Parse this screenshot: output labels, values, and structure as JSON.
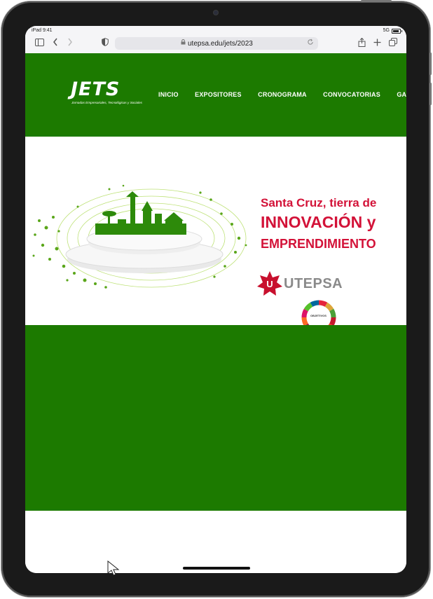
{
  "status_bar": {
    "device_time": "iPad 9:41",
    "network": "5G"
  },
  "browser": {
    "url": "utepsa.edu/jets/2023"
  },
  "site": {
    "logo_text": "JETS",
    "logo_tagline": "Jornadas Empresariales, Tecnológicas y Sociales",
    "nav": [
      "INICIO",
      "EXPOSITORES",
      "CRONOGRAMA",
      "CONVOCATORIAS",
      "GALERÍ"
    ]
  },
  "banner": {
    "line1": "Santa Cruz, tierra de",
    "line2": "INNOVACIÓN y",
    "line3": "EMPRENDIMIENTO",
    "university": "UTEPSA",
    "ods_label": "OBJETIVOS"
  },
  "colors": {
    "brand_green": "#1c7a00",
    "accent_red": "#d31238",
    "utepsa_gray": "#8a8a8a"
  }
}
